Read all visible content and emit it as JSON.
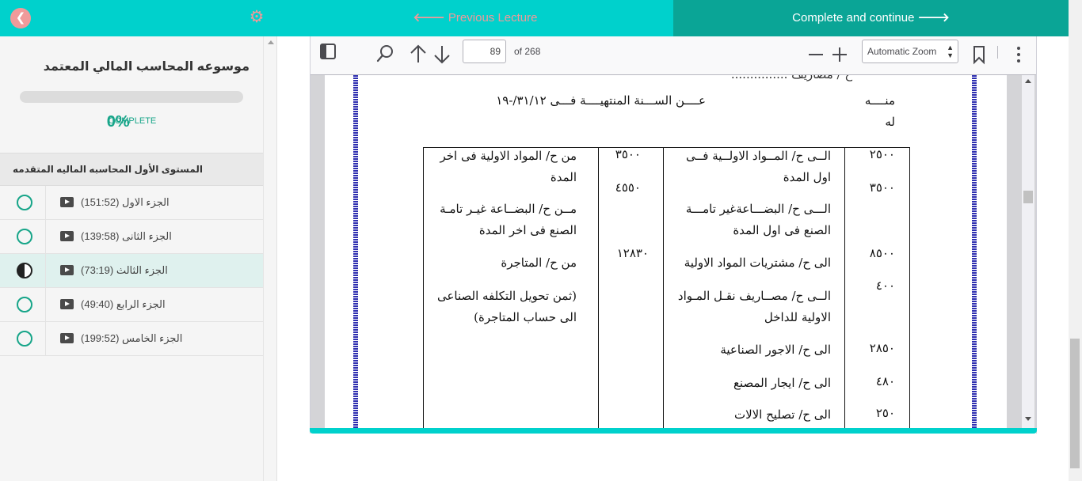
{
  "sidebar": {
    "course_title": "موسوعه المحاسب المالي المعتمد",
    "progress_fraction": 0,
    "progress_percent": "0%",
    "progress_label": "COMPLETE",
    "section_title": "المستوى الأول المحاسبه الماليه المتقدمه",
    "lectures": [
      {
        "name": "الجزء الاول (151:52)",
        "status": "not-started"
      },
      {
        "name": "الجزء الثانى (139:58)",
        "status": "not-started"
      },
      {
        "name": "الجزء الثالث (73:19)",
        "status": "in-progress"
      },
      {
        "name": "الجزء الرابع (49:40)",
        "status": "not-started"
      },
      {
        "name": "الجزء الخامس (199:52)",
        "status": "not-started"
      }
    ]
  },
  "nav": {
    "previous_label": "Previous Lecture",
    "next_label": "Complete and continue"
  },
  "pdf_toolbar": {
    "page_number": "89",
    "page_count_label": "of 268",
    "zoom_label": "Automatic Zoom"
  },
  "document": {
    "top_cut": "ح / مصاريف ...............",
    "header_left": "منــــه",
    "header_left2": "له",
    "header_center": "عــــن الســـنة المنتهيــــة فـــى ٣١/١٢/-١٩",
    "left_amounts": [
      "٢٥٠٠",
      "٣٥٠٠",
      "٨٥٠٠",
      "٤٠٠",
      "٢٨٥٠",
      "٤٨٠",
      "٢٥٠"
    ],
    "left_items": [
      "الــى ح/ المــواد الاولــية فــى اول المدة",
      "الـــى ح/ البضـــاعةغير تامـــة الصنع فى اول المدة",
      "الى ح/ مشتريات المواد الاولية",
      "الــى ح/ مصــاريف نقـل المـواد الاولية للداخل",
      "الى ح/ الاجور الصناعية",
      "الى ح/ ايجار المصنع",
      "الى ح/ تصليح الالات"
    ],
    "right_amounts": [
      "٣٥٠٠",
      "٤٥٥٠",
      "١٢٨٣٠"
    ],
    "right_items": [
      "من ح/ المواد الاولية فى اخر المدة",
      "مــن ح/ البضــاعة غيـر تامـة الصنع فى اخر المدة",
      "من ح/ المتاجرة",
      "(ثمن تحويل التكلفه الصناعى الى حساب المتاجرة)"
    ]
  },
  "colors": {
    "teal_header": "#00d1cc",
    "teal_dark": "#0aa596",
    "accent_green": "#17a589",
    "muted_pink": "#ef9a9a"
  },
  "icons": {
    "back": "back-icon",
    "settings": "gear-icon",
    "play": "play-icon",
    "sidebar_toggle": "sidebar-toggle-icon",
    "search": "search-icon",
    "prev_page": "arrow-up-icon",
    "next_page": "arrow-down-icon",
    "zoom_out": "minus-icon",
    "zoom_in": "plus-icon",
    "bookmark": "bookmark-icon",
    "more": "kebab-menu-icon"
  }
}
